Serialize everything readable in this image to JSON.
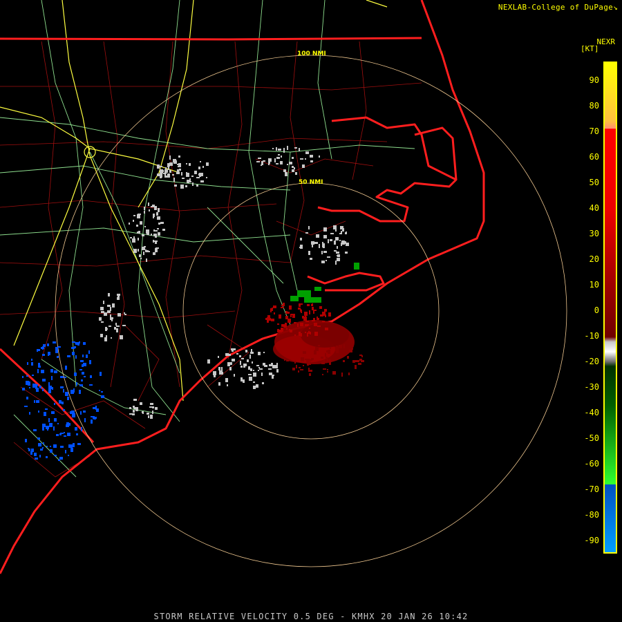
{
  "credit": "NEXLAB-College of DuPage",
  "credit_icon": "cursor-arrow-icon",
  "product": "NEXR",
  "units": "[KT]",
  "caption": "STORM RELATIVE VELOCITY 0.5 DEG - KMHX 20 JAN 26 10:42",
  "ring_labels": {
    "outer": "100 NMI",
    "inner": "50 NMI"
  },
  "legend": {
    "ticks": [
      "90",
      "80",
      "70",
      "60",
      "50",
      "40",
      "30",
      "20",
      "10",
      "0",
      "-10",
      "-20",
      "-30",
      "-40",
      "-50",
      "-60",
      "-70",
      "-80",
      "-90"
    ]
  },
  "colors": {
    "state_lines": "#ff2020",
    "county_lines": "#b01010",
    "interstates": "#ffff40",
    "highways": "#90ee90",
    "range_rings": "#f0c890",
    "outbound": "#8b0000",
    "inbound_green": "#00a000",
    "inbound_blue": "#0050ff",
    "near_zero": "#c8c8c8"
  }
}
